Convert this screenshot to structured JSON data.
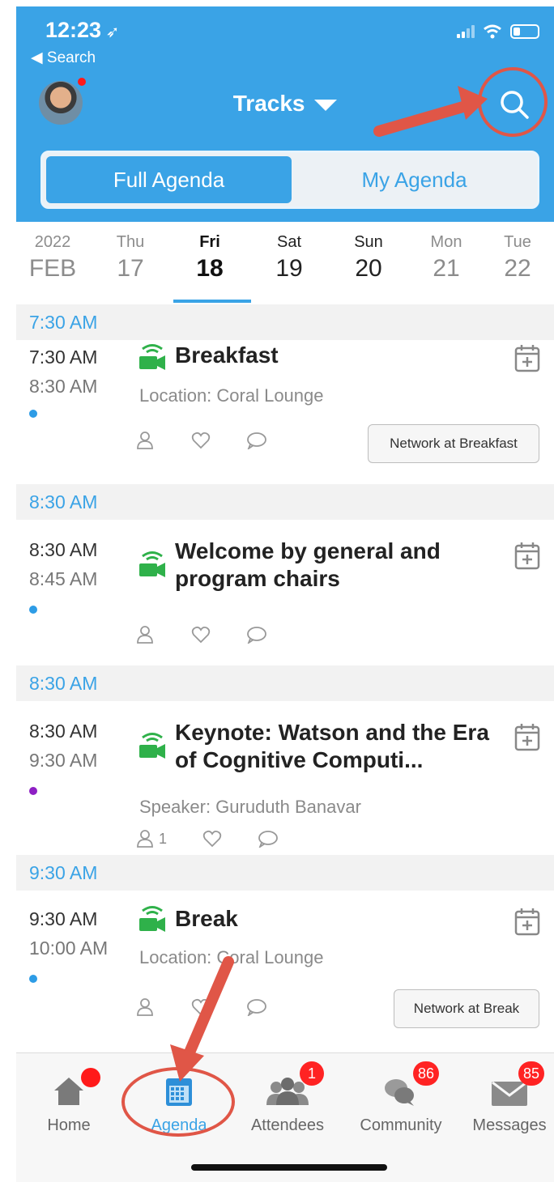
{
  "status_bar": {
    "time": "12:23",
    "back_label": "◀ Search"
  },
  "header": {
    "title": "Tracks"
  },
  "segments": [
    {
      "label": "Full Agenda",
      "selected": true
    },
    {
      "label": "My Agenda",
      "selected": false
    }
  ],
  "date_strip": {
    "year": "2022",
    "month": "FEB",
    "days": [
      {
        "dow": "Thu",
        "num": "17"
      },
      {
        "dow": "Fri",
        "num": "18",
        "selected": true
      },
      {
        "dow": "Sat",
        "num": "19"
      },
      {
        "dow": "Sun",
        "num": "20"
      },
      {
        "dow": "Mon",
        "num": "21"
      },
      {
        "dow": "Tue",
        "num": "22"
      }
    ]
  },
  "agenda": [
    {
      "section": "7:30 AM",
      "start": "7:30 AM",
      "end": "8:30 AM",
      "title": "Breakfast",
      "subtitle": "Location: Coral Lounge",
      "dot_color": "#2d9ce6",
      "attendee_count": "",
      "network_button": "Network at Breakfast"
    },
    {
      "section": "8:30 AM",
      "start": "8:30 AM",
      "end": "8:45 AM",
      "title": "Welcome by general and program chairs",
      "subtitle": "",
      "dot_color": "#2d9ce6",
      "attendee_count": "",
      "network_button": ""
    },
    {
      "section": "8:30 AM",
      "start": "8:30 AM",
      "end": "9:30 AM",
      "title": "Keynote: Watson and the Era of Cognitive Computi...",
      "subtitle": "Speaker: Guruduth Banavar",
      "dot_color": "#8e1fc4",
      "attendee_count": "1",
      "network_button": ""
    },
    {
      "section": "9:30 AM",
      "start": "9:30 AM",
      "end": "10:00 AM",
      "title": "Break",
      "subtitle": "Location: Coral Lounge",
      "dot_color": "#2d9ce6",
      "attendee_count": "",
      "network_button": "Network at Break"
    }
  ],
  "tabbar": {
    "tabs": [
      {
        "label": "Home",
        "icon": "home-icon",
        "badge": ""
      },
      {
        "label": "Agenda",
        "icon": "calendar-icon",
        "badge": "",
        "selected": true
      },
      {
        "label": "Attendees",
        "icon": "people-icon",
        "badge": "1"
      },
      {
        "label": "Community",
        "icon": "chat-bubbles-icon",
        "badge": "86"
      },
      {
        "label": "Messages",
        "icon": "envelope-icon",
        "badge": "85"
      }
    ]
  },
  "colors": {
    "accent": "#3aa3e6",
    "live_green": "#2fb14a",
    "annotation_red": "#e05647",
    "badge_red": "#ff2323"
  }
}
